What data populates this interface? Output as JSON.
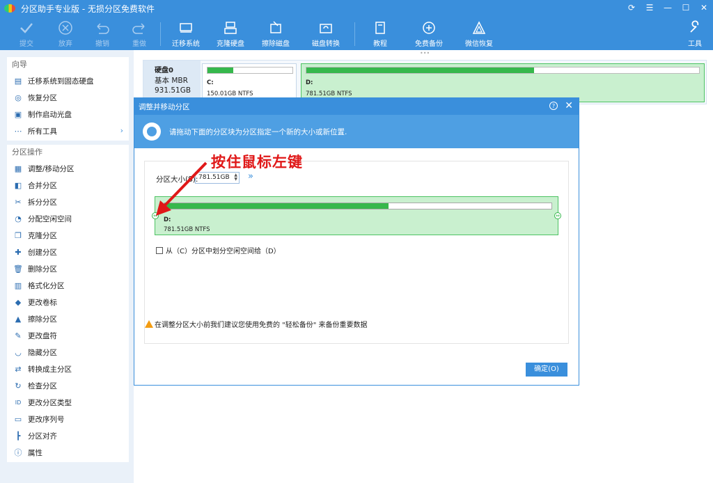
{
  "window": {
    "title": "分区助手专业版 - 无损分区免费软件"
  },
  "toolbar": {
    "submit": "提交",
    "discard": "放弃",
    "undo": "撤销",
    "redo": "重做",
    "migrate_os": "迁移系统",
    "clone_disk": "克隆硬盘",
    "wipe_disk": "擦除磁盘",
    "convert_disk": "磁盘转换",
    "tutorial": "教程",
    "free_backup": "免费备份",
    "wechat_restore": "微信恢复",
    "tools": "工具"
  },
  "sidebar": {
    "guide": {
      "title": "向导",
      "items": [
        {
          "label": "迁移系统到固态硬盘",
          "icon": "migrate-icon"
        },
        {
          "label": "恢复分区",
          "icon": "recover-icon"
        },
        {
          "label": "制作启动光盘",
          "icon": "boot-disc-icon"
        },
        {
          "label": "所有工具",
          "icon": "more-icon"
        }
      ]
    },
    "ops": {
      "title": "分区操作",
      "items": [
        {
          "label": "调整/移动分区",
          "icon": "resize-icon"
        },
        {
          "label": "合并分区",
          "icon": "merge-icon"
        },
        {
          "label": "拆分分区",
          "icon": "split-icon"
        },
        {
          "label": "分配空闲空间",
          "icon": "allocate-icon"
        },
        {
          "label": "克隆分区",
          "icon": "clone-icon"
        },
        {
          "label": "创建分区",
          "icon": "create-icon"
        },
        {
          "label": "删除分区",
          "icon": "delete-icon"
        },
        {
          "label": "格式化分区",
          "icon": "format-icon"
        },
        {
          "label": "更改卷标",
          "icon": "label-icon"
        },
        {
          "label": "擦除分区",
          "icon": "wipe-icon"
        },
        {
          "label": "更改盘符",
          "icon": "drive-letter-icon"
        },
        {
          "label": "隐藏分区",
          "icon": "hide-icon"
        },
        {
          "label": "转换成主分区",
          "icon": "convert-icon"
        },
        {
          "label": "检查分区",
          "icon": "check-icon"
        },
        {
          "label": "更改分区类型",
          "icon": "id-icon"
        },
        {
          "label": "更改序列号",
          "icon": "serial-icon"
        },
        {
          "label": "分区对齐",
          "icon": "align-icon"
        },
        {
          "label": "属性",
          "icon": "info-icon"
        }
      ]
    }
  },
  "disk": {
    "name": "硬盘0",
    "type": "基本 MBR",
    "size": "931.51GB",
    "partitions": [
      {
        "label": "C:",
        "size": "150.01GB NTFS",
        "used": 0.3
      },
      {
        "label": "D:",
        "size": "781.51GB NTFS",
        "used": 0.58
      }
    ]
  },
  "dialog": {
    "title": "调整并移动分区",
    "banner": "请拖动下面的分区块为分区指定一个新的大小或新位置.",
    "size_label": "分区大小(S):",
    "size_value": "781.51GB",
    "partition": {
      "label": "D:",
      "size": "781.51GB NTFS",
      "used": 0.58
    },
    "checkbox_label": "从（C）分区中划分空闲空间给（D）",
    "warning": "在调整分区大小前我们建议您使用免费的 \"轻松备份\" 来备份重要数据",
    "ok": "确定(O)"
  },
  "annotation": {
    "text": "按住鼠标左键",
    "color": "#e01818"
  },
  "colors": {
    "accent": "#3a8fdc",
    "partition_green": "#36b84c",
    "partition_bg": "#c9f0cf"
  }
}
